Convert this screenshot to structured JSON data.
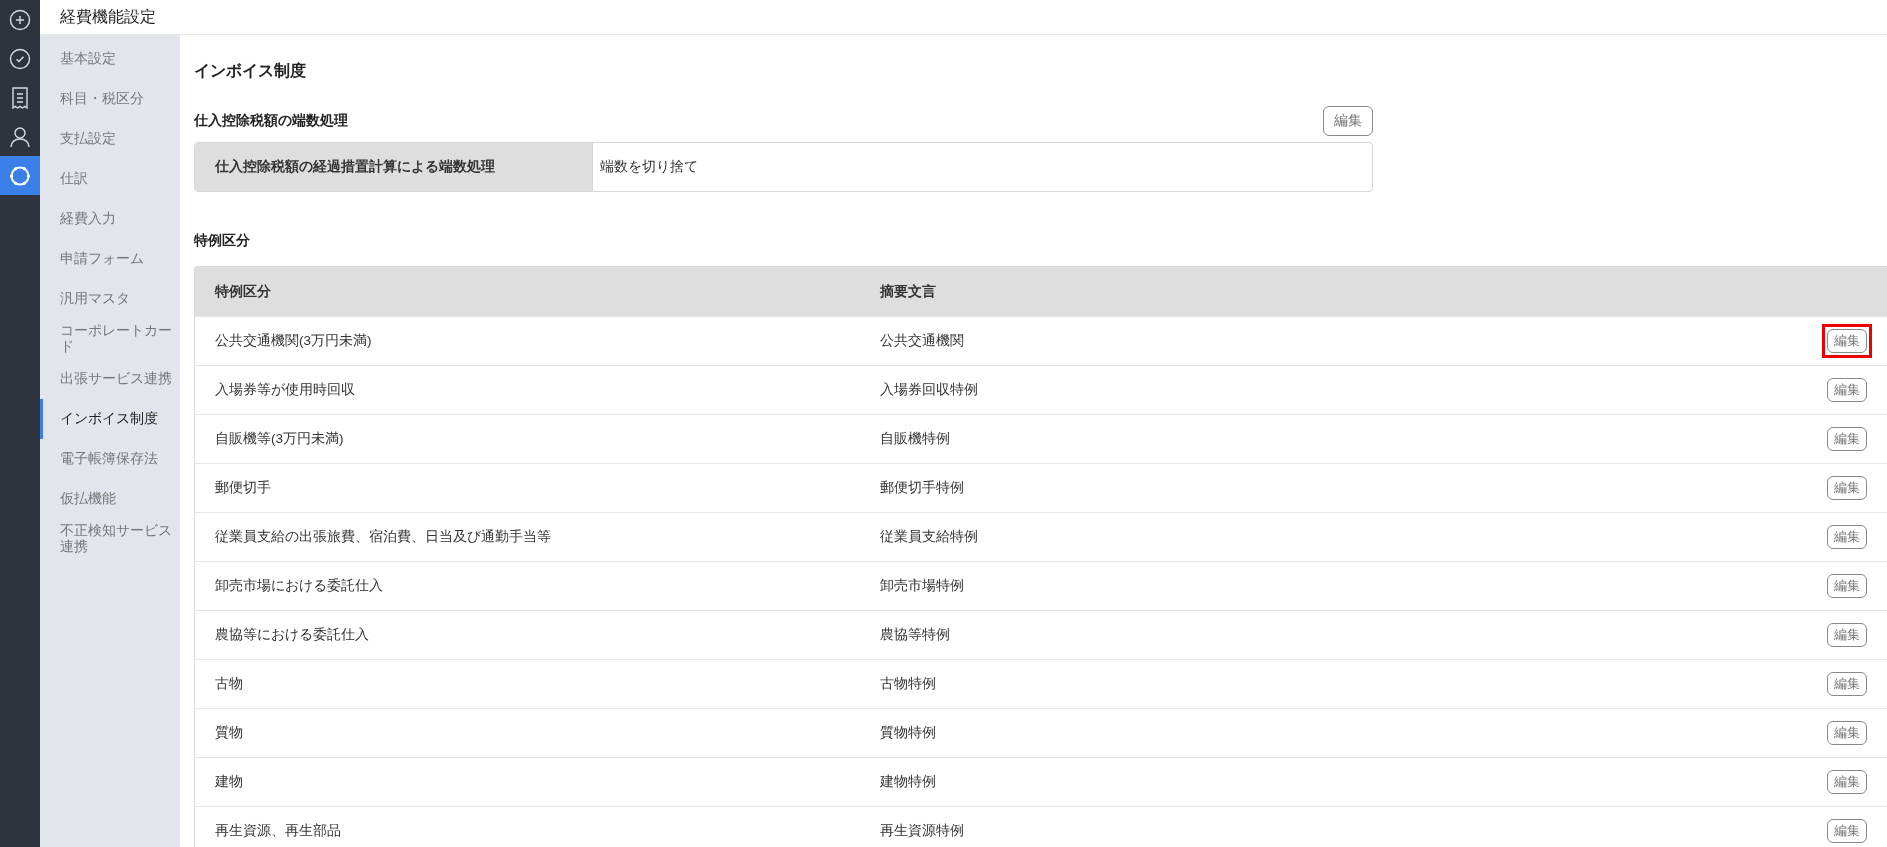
{
  "rail": [
    {
      "kind": "plus",
      "selected": false
    },
    {
      "kind": "check",
      "selected": false
    },
    {
      "kind": "receipt",
      "selected": false
    },
    {
      "kind": "person",
      "selected": false
    },
    {
      "kind": "gear",
      "selected": true
    }
  ],
  "header": {
    "title": "経費機能設定"
  },
  "sidebar": {
    "items": [
      {
        "label": "基本設定",
        "selected": false
      },
      {
        "label": "科目・税区分",
        "selected": false
      },
      {
        "label": "支払設定",
        "selected": false
      },
      {
        "label": "仕訳",
        "selected": false
      },
      {
        "label": "経費入力",
        "selected": false
      },
      {
        "label": "申請フォーム",
        "selected": false
      },
      {
        "label": "汎用マスタ",
        "selected": false
      },
      {
        "label": "コーポレートカード",
        "selected": false
      },
      {
        "label": "出張サービス連携",
        "selected": false
      },
      {
        "label": "インボイス制度",
        "selected": true
      },
      {
        "label": "電子帳簿保存法",
        "selected": false
      },
      {
        "label": "仮払機能",
        "selected": false
      },
      {
        "label": "不正検知サービス連携",
        "selected": false
      }
    ]
  },
  "page_title": "インボイス制度",
  "rounding": {
    "title": "仕入控除税額の端数処理",
    "edit_button": "編集",
    "label": "仕入控除税額の経過措置計算による端数処理",
    "value": "端数を切り捨て"
  },
  "special": {
    "title": "特例区分",
    "columns": [
      "特例区分",
      "摘要文言"
    ],
    "rows": [
      {
        "category": "公共交通機関(3万円未満)",
        "summary": "公共交通機関",
        "button": "編集",
        "highlighted": true
      },
      {
        "category": "入場券等が使用時回収",
        "summary": "入場券回収特例",
        "button": "編集",
        "highlighted": false
      },
      {
        "category": "自販機等(3万円未満)",
        "summary": "自販機特例",
        "button": "編集",
        "highlighted": false
      },
      {
        "category": "郵便切手",
        "summary": "郵便切手特例",
        "button": "編集",
        "highlighted": false
      },
      {
        "category": "従業員支給の出張旅費、宿泊費、日当及び通勤手当等",
        "summary": "従業員支給特例",
        "button": "編集",
        "highlighted": false
      },
      {
        "category": "卸売市場における委託仕入",
        "summary": "卸売市場特例",
        "button": "編集",
        "highlighted": false
      },
      {
        "category": "農協等における委託仕入",
        "summary": "農協等特例",
        "button": "編集",
        "highlighted": false
      },
      {
        "category": "古物",
        "summary": "古物特例",
        "button": "編集",
        "highlighted": false
      },
      {
        "category": "質物",
        "summary": "質物特例",
        "button": "編集",
        "highlighted": false
      },
      {
        "category": "建物",
        "summary": "建物特例",
        "button": "編集",
        "highlighted": false
      },
      {
        "category": "再生資源、再生部品",
        "summary": "再生資源特例",
        "button": "編集",
        "highlighted": false
      }
    ]
  }
}
